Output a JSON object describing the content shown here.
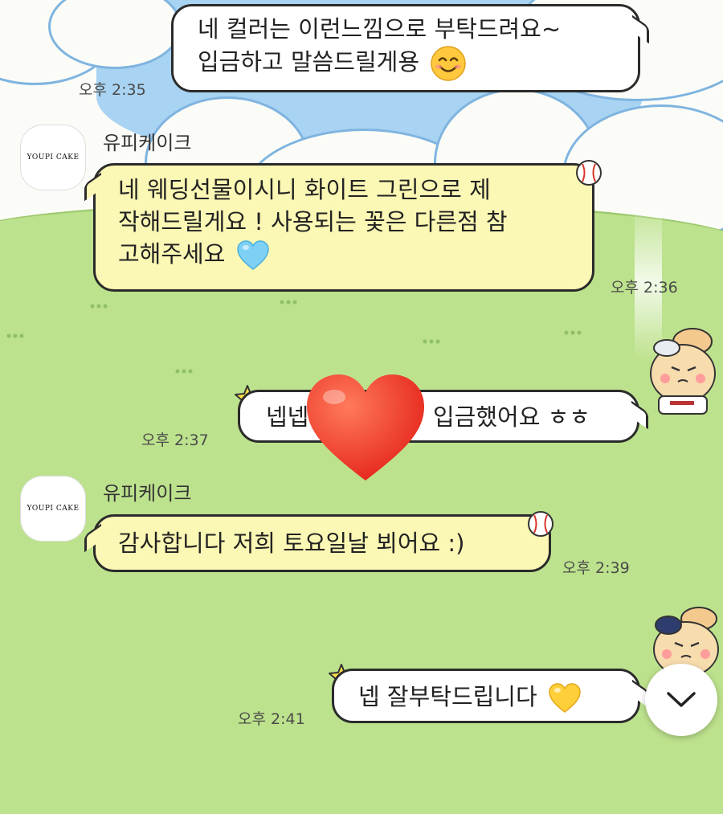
{
  "messages": [
    {
      "id": "m1",
      "direction": "out",
      "lines": [
        "네 컬러는 이런느낌으로 부탁드려요~",
        "입금하고 말씀드릴게용"
      ],
      "emoji": "smiling-face",
      "time": "오후 2:35"
    },
    {
      "id": "m2",
      "direction": "in",
      "sender": "유피케이크",
      "lines": [
        "네 웨딩선물이시니 화이트 그린으로 제",
        "작해드릴게요 ! 사용되는 꽃은 다른점 참",
        "고해주세요"
      ],
      "emoji": "light-blue-heart",
      "time": "오후 2:36"
    },
    {
      "id": "m3",
      "direction": "out",
      "text_left": "넵넵",
      "text_right": "입금했어요 ㅎㅎ",
      "reaction": "red-heart",
      "time": "오후 2:37"
    },
    {
      "id": "m4",
      "direction": "in",
      "sender": "유피케이크",
      "lines": [
        "감사합니다 저희 토요일날 뵈어요 :)"
      ],
      "time": "오후 2:39"
    },
    {
      "id": "m5",
      "direction": "out",
      "lines": [
        "넵 잘부탁드립니다"
      ],
      "emoji": "yellow-heart",
      "time": "오후 2:41"
    }
  ],
  "avatar_logo_text": "YOUPI CAKE",
  "colors": {
    "incoming_bubble": "#fbf7b4",
    "outgoing_bubble": "#ffffff",
    "grass": "#bde28d",
    "sky": "#a9d3f2"
  }
}
